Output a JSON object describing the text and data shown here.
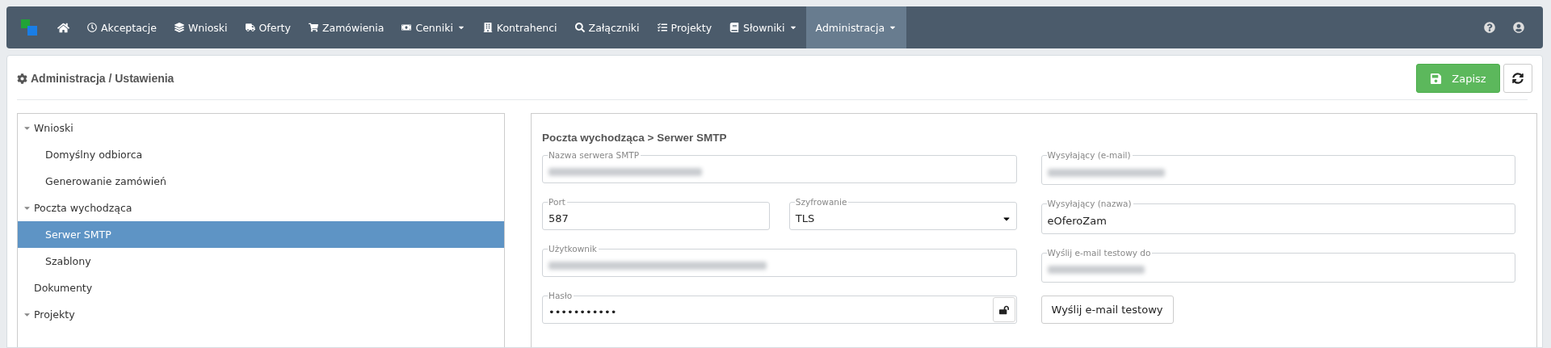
{
  "navbar": {
    "items": [
      {
        "label": "Akceptacje",
        "dropdown": false,
        "selected": false
      },
      {
        "label": "Wnioski",
        "dropdown": false,
        "selected": false
      },
      {
        "label": "Oferty",
        "dropdown": false,
        "selected": false
      },
      {
        "label": "Zamówienia",
        "dropdown": false,
        "selected": false
      },
      {
        "label": "Cenniki",
        "dropdown": true,
        "selected": false
      },
      {
        "label": "Kontrahenci",
        "dropdown": false,
        "selected": false
      },
      {
        "label": "Załączniki",
        "dropdown": false,
        "selected": false
      },
      {
        "label": "Projekty",
        "dropdown": false,
        "selected": false
      },
      {
        "label": "Słowniki",
        "dropdown": true,
        "selected": false
      },
      {
        "label": "Administracja",
        "dropdown": true,
        "selected": true
      }
    ]
  },
  "page": {
    "title": "Administracja / Ustawienia",
    "buttons": [
      {
        "kind": "save",
        "label": "Zapisz"
      },
      {
        "kind": "refresh"
      }
    ]
  },
  "tree": [
    {
      "label": "Wnioski",
      "expanded": true,
      "selected": false,
      "children": [
        {
          "label": "Domyślny odbiorca",
          "selected": false
        },
        {
          "label": "Generowanie zamówień",
          "selected": false
        }
      ]
    },
    {
      "label": "Poczta wychodząca",
      "expanded": true,
      "selected": false,
      "children": [
        {
          "label": "Serwer SMTP",
          "selected": true
        },
        {
          "label": "Szablony",
          "selected": false
        }
      ]
    },
    {
      "label": "Dokumenty",
      "selected": false
    },
    {
      "label": "Projekty",
      "expanded": true,
      "selected": false
    }
  ],
  "form": {
    "title": "Poczta wychodząca > Serwer SMTP",
    "left": [
      [
        {
          "kind": "text",
          "label": "Nazwa serwera SMTP",
          "redacted": true
        }
      ],
      [
        {
          "kind": "text",
          "label": "Port",
          "value": "587",
          "redacted": false
        },
        {
          "kind": "select",
          "label": "Szyfrowanie",
          "value": "TLS",
          "redacted": false
        }
      ],
      [
        {
          "kind": "text",
          "label": "Użytkownik",
          "redacted": true
        }
      ],
      [
        {
          "kind": "password",
          "label": "Hasło",
          "value": "•••••••••••",
          "redacted": false
        }
      ]
    ],
    "right": [
      {
        "kind": "text",
        "label": "Wysyłający (e-mail)",
        "redacted": true
      },
      {
        "kind": "text",
        "label": "Wysyłający (nazwa)",
        "value": "eOferoZam",
        "redacted": false
      },
      {
        "kind": "text",
        "label": "Wyślij e-mail testowy do",
        "redacted": true
      },
      {
        "kind": "button",
        "label": "Wyślij e-mail testowy"
      }
    ]
  }
}
